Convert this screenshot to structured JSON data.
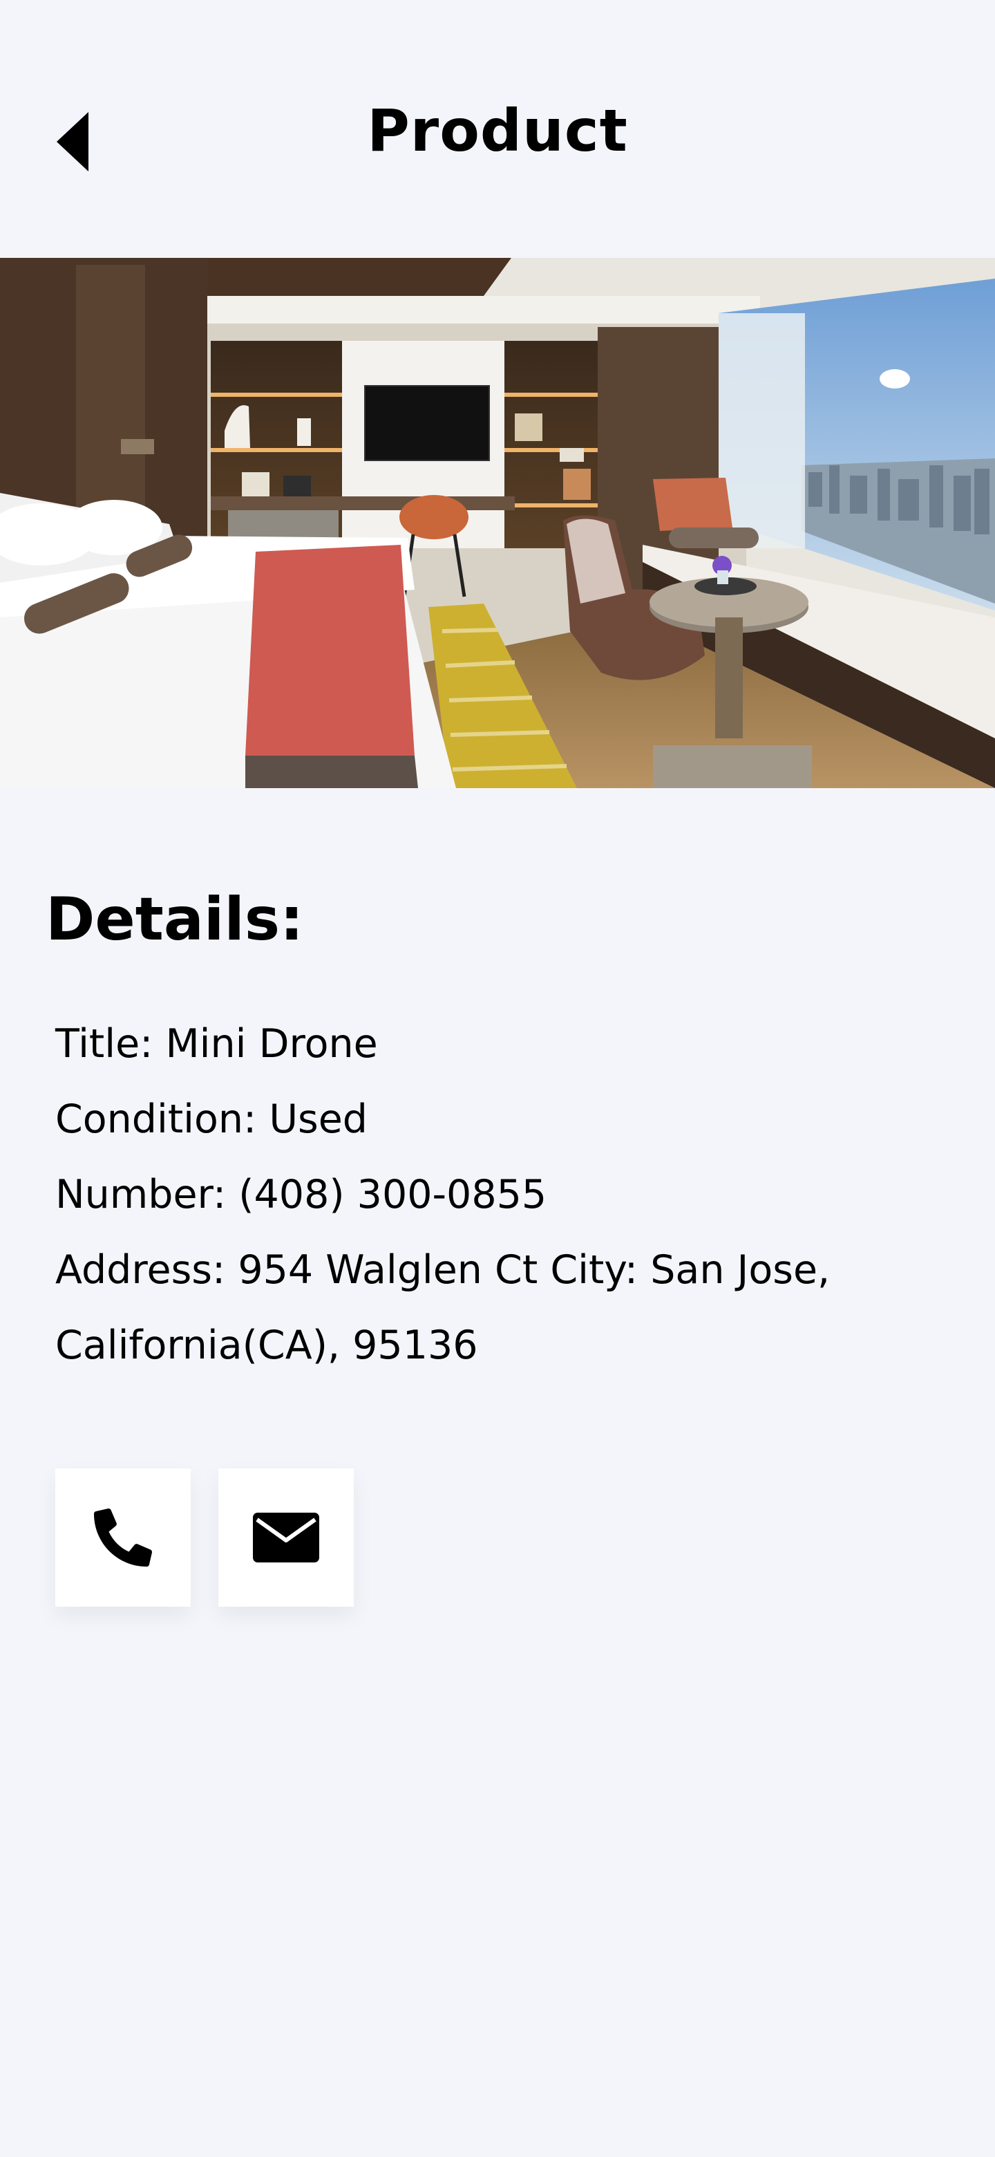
{
  "header": {
    "title": "Product",
    "back_icon": "caret-left-icon"
  },
  "hero": {
    "image_icon": "hotel-room-photo"
  },
  "details": {
    "heading": "Details:",
    "title_line": "Title: Mini Drone",
    "condition_line": "Condition: Used",
    "number_line": "Number: (408) 300-0855",
    "address_line_1": "Address: 954 Walglen Ct City: San Jose,",
    "address_line_2": "California(CA), 95136"
  },
  "actions": {
    "call_icon": "phone-icon",
    "email_icon": "envelope-icon"
  },
  "colors": {
    "background": "#f4f5fa",
    "card": "#ffffff",
    "text": "#000000"
  }
}
